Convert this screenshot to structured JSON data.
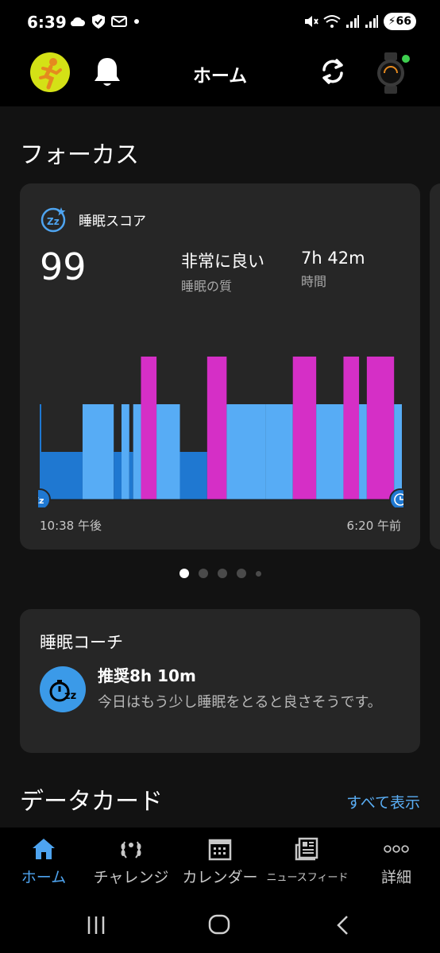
{
  "status_bar": {
    "time": "6:39",
    "battery": "66",
    "icons_left": [
      "cloud-icon",
      "shield-icon",
      "mail-icon",
      "dot-icon"
    ],
    "icons_right": [
      "mute-icon",
      "wifi-icon",
      "signal-icon",
      "signal-icon",
      "battery-icon"
    ]
  },
  "app_bar": {
    "title": "ホーム",
    "icons": [
      "avatar-runner-icon",
      "bell-icon",
      "sync-icon",
      "watch-device-icon"
    ],
    "device_status_color": "#3ecf4f"
  },
  "focus": {
    "section_title": "フォーカス",
    "sleep_card": {
      "label": "睡眠スコア",
      "score": "99",
      "quality_value": "非常に良い",
      "quality_label": "睡眠の質",
      "duration_value": "7h 42m",
      "duration_label": "時間",
      "start_time": "10:38 午後",
      "end_time": "6:20 午前"
    },
    "pager": {
      "count": 5,
      "active_index": 0
    }
  },
  "sleep_chart": {
    "type": "bar",
    "stages": [
      "deep",
      "light",
      "rem"
    ],
    "stage_colors": {
      "deep": "#1f78d1",
      "light": "#57acf5",
      "rem": "#d52fc6",
      "start_marker": "#1f78d1"
    },
    "segments": [
      {
        "stage": "deep",
        "duration": 11
      },
      {
        "stage": "light",
        "duration": 8
      },
      {
        "stage": "deep",
        "duration": 2
      },
      {
        "stage": "light",
        "duration": 2
      },
      {
        "stage": "deep",
        "duration": 1
      },
      {
        "stage": "light",
        "duration": 2
      },
      {
        "stage": "rem",
        "duration": 4
      },
      {
        "stage": "light",
        "duration": 6
      },
      {
        "stage": "deep",
        "duration": 7
      },
      {
        "stage": "rem",
        "duration": 5
      },
      {
        "stage": "light",
        "duration": 10
      },
      {
        "stage": "light",
        "duration": 7
      },
      {
        "stage": "rem",
        "duration": 6
      },
      {
        "stage": "light",
        "duration": 7
      },
      {
        "stage": "rem",
        "duration": 4
      },
      {
        "stage": "light",
        "duration": 2
      },
      {
        "stage": "rem",
        "duration": 7
      },
      {
        "stage": "light",
        "duration": 2
      }
    ]
  },
  "coach": {
    "title": "睡眠コーチ",
    "recommendation": "推奨8h 10m",
    "description": "今日はもう少し睡眠をとると良さそうです。"
  },
  "data_cards": {
    "section_title": "データカード",
    "see_all": "すべて表示"
  },
  "bottom_nav": [
    {
      "label": "ホーム",
      "icon": "home-icon",
      "active": true
    },
    {
      "label": "チャレンジ",
      "icon": "laurel-icon",
      "active": false
    },
    {
      "label": "カレンダー",
      "icon": "calendar-icon",
      "active": false
    },
    {
      "label": "ニュースフィード",
      "icon": "newsfeed-icon",
      "active": false
    },
    {
      "label": "詳細",
      "icon": "more-icon",
      "active": false
    }
  ],
  "accent_color": "#4ea4f0"
}
